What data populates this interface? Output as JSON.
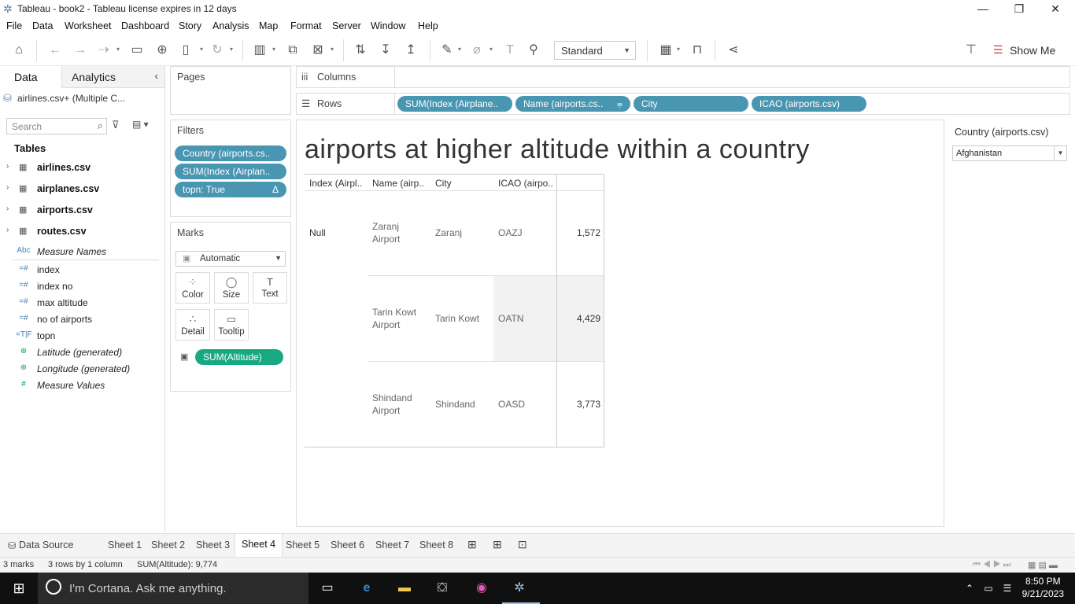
{
  "window": {
    "title": "Tableau - book2 - Tableau license expires in 12 days"
  },
  "menu": [
    "File",
    "Data",
    "Worksheet",
    "Dashboard",
    "Story",
    "Analysis",
    "Map",
    "Format",
    "Server",
    "Window",
    "Help"
  ],
  "toolbar": {
    "fit_select": "Standard",
    "show_me": "Show Me"
  },
  "left_panel": {
    "tab_data": "Data",
    "tab_analytics": "Analytics",
    "datasource": "airlines.csv+ (Multiple C...",
    "search_placeholder": "Search",
    "tables_heading": "Tables",
    "tables": [
      "airlines.csv",
      "airplanes.csv",
      "airports.csv",
      "routes.csv"
    ],
    "fields": [
      {
        "icon": "Abc",
        "name": "Measure Names",
        "italic": true
      },
      {
        "icon": "=#",
        "name": "index",
        "italic": false
      },
      {
        "icon": "=#",
        "name": "index no",
        "italic": false
      },
      {
        "icon": "=#",
        "name": "max altitude",
        "italic": false
      },
      {
        "icon": "=#",
        "name": "no of airports",
        "italic": false
      },
      {
        "icon": "=T|F",
        "name": "topn",
        "italic": false
      },
      {
        "icon": "globe",
        "name": "Latitude (generated)",
        "italic": true
      },
      {
        "icon": "globe",
        "name": "Longitude (generated)",
        "italic": true
      },
      {
        "icon": "#",
        "name": "Measure Values",
        "italic": true
      }
    ]
  },
  "pages": {
    "label": "Pages"
  },
  "filters": {
    "label": "Filters",
    "pills": [
      "Country (airports.cs..",
      "SUM(Index (Airplan..",
      "topn: True"
    ]
  },
  "marks": {
    "label": "Marks",
    "type": "Automatic",
    "buttons": [
      "Color",
      "Size",
      "Text",
      "Detail",
      "Tooltip"
    ],
    "pill": "SUM(Altitude)"
  },
  "shelves": {
    "columns_label": "Columns",
    "rows_label": "Rows",
    "rows_pills": [
      "SUM(Index (Airplane..",
      "Name (airports.cs..",
      "City",
      "ICAO (airports.csv)"
    ]
  },
  "view": {
    "title": "airports at higher altitude within a country",
    "headers": [
      "Index (Airpl..",
      "Name (airp..",
      "City",
      "ICAO (airpo.."
    ],
    "index_value": "Null",
    "rows": [
      {
        "name": "Zaranj Airport",
        "city": "Zaranj",
        "icao": "OAZJ",
        "value": "1,572"
      },
      {
        "name": "Tarin Kowt Airport",
        "city": "Tarin Kowt",
        "icao": "OATN",
        "value": "4,429"
      },
      {
        "name": "Shindand Airport",
        "city": "Shindand",
        "icao": "OASD",
        "value": "3,773"
      }
    ]
  },
  "quick_filter": {
    "label": "Country (airports.csv)",
    "value": "Afghanistan"
  },
  "sheet_tabs": {
    "datasource": "Data Source",
    "sheets": [
      "Sheet 1",
      "Sheet 2",
      "Sheet 3",
      "Sheet 4",
      "Sheet 5",
      "Sheet 6",
      "Sheet 7",
      "Sheet 8"
    ],
    "active": "Sheet 4"
  },
  "status": {
    "marks": "3 marks",
    "dims": "3 rows by 1 column",
    "sum": "SUM(Altitude): 9,774"
  },
  "taskbar": {
    "cortana": "I'm Cortana. Ask me anything.",
    "time": "8:50 PM",
    "date": "9/21/2023"
  }
}
